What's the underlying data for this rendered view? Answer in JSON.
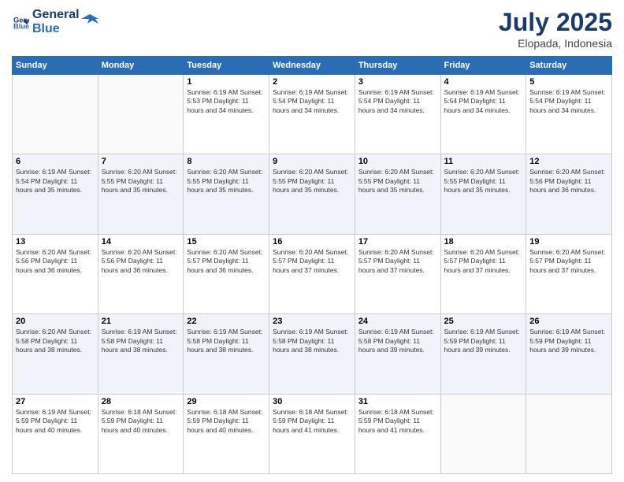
{
  "header": {
    "logo_line1": "General",
    "logo_line2": "Blue",
    "title": "July 2025",
    "subtitle": "Elopada, Indonesia"
  },
  "weekdays": [
    "Sunday",
    "Monday",
    "Tuesday",
    "Wednesday",
    "Thursday",
    "Friday",
    "Saturday"
  ],
  "weeks": [
    [
      {
        "day": "",
        "info": ""
      },
      {
        "day": "",
        "info": ""
      },
      {
        "day": "1",
        "info": "Sunrise: 6:19 AM\nSunset: 5:53 PM\nDaylight: 11 hours and 34 minutes."
      },
      {
        "day": "2",
        "info": "Sunrise: 6:19 AM\nSunset: 5:54 PM\nDaylight: 11 hours and 34 minutes."
      },
      {
        "day": "3",
        "info": "Sunrise: 6:19 AM\nSunset: 5:54 PM\nDaylight: 11 hours and 34 minutes."
      },
      {
        "day": "4",
        "info": "Sunrise: 6:19 AM\nSunset: 5:54 PM\nDaylight: 11 hours and 34 minutes."
      },
      {
        "day": "5",
        "info": "Sunrise: 6:19 AM\nSunset: 5:54 PM\nDaylight: 11 hours and 34 minutes."
      }
    ],
    [
      {
        "day": "6",
        "info": "Sunrise: 6:19 AM\nSunset: 5:54 PM\nDaylight: 11 hours and 35 minutes."
      },
      {
        "day": "7",
        "info": "Sunrise: 6:20 AM\nSunset: 5:55 PM\nDaylight: 11 hours and 35 minutes."
      },
      {
        "day": "8",
        "info": "Sunrise: 6:20 AM\nSunset: 5:55 PM\nDaylight: 11 hours and 35 minutes."
      },
      {
        "day": "9",
        "info": "Sunrise: 6:20 AM\nSunset: 5:55 PM\nDaylight: 11 hours and 35 minutes."
      },
      {
        "day": "10",
        "info": "Sunrise: 6:20 AM\nSunset: 5:55 PM\nDaylight: 11 hours and 35 minutes."
      },
      {
        "day": "11",
        "info": "Sunrise: 6:20 AM\nSunset: 5:55 PM\nDaylight: 11 hours and 35 minutes."
      },
      {
        "day": "12",
        "info": "Sunrise: 6:20 AM\nSunset: 5:56 PM\nDaylight: 11 hours and 36 minutes."
      }
    ],
    [
      {
        "day": "13",
        "info": "Sunrise: 6:20 AM\nSunset: 5:56 PM\nDaylight: 11 hours and 36 minutes."
      },
      {
        "day": "14",
        "info": "Sunrise: 6:20 AM\nSunset: 5:56 PM\nDaylight: 11 hours and 36 minutes."
      },
      {
        "day": "15",
        "info": "Sunrise: 6:20 AM\nSunset: 5:57 PM\nDaylight: 11 hours and 36 minutes."
      },
      {
        "day": "16",
        "info": "Sunrise: 6:20 AM\nSunset: 5:57 PM\nDaylight: 11 hours and 37 minutes."
      },
      {
        "day": "17",
        "info": "Sunrise: 6:20 AM\nSunset: 5:57 PM\nDaylight: 11 hours and 37 minutes."
      },
      {
        "day": "18",
        "info": "Sunrise: 6:20 AM\nSunset: 5:57 PM\nDaylight: 11 hours and 37 minutes."
      },
      {
        "day": "19",
        "info": "Sunrise: 6:20 AM\nSunset: 5:57 PM\nDaylight: 11 hours and 37 minutes."
      }
    ],
    [
      {
        "day": "20",
        "info": "Sunrise: 6:20 AM\nSunset: 5:58 PM\nDaylight: 11 hours and 38 minutes."
      },
      {
        "day": "21",
        "info": "Sunrise: 6:19 AM\nSunset: 5:58 PM\nDaylight: 11 hours and 38 minutes."
      },
      {
        "day": "22",
        "info": "Sunrise: 6:19 AM\nSunset: 5:58 PM\nDaylight: 11 hours and 38 minutes."
      },
      {
        "day": "23",
        "info": "Sunrise: 6:19 AM\nSunset: 5:58 PM\nDaylight: 11 hours and 38 minutes."
      },
      {
        "day": "24",
        "info": "Sunrise: 6:19 AM\nSunset: 5:58 PM\nDaylight: 11 hours and 39 minutes."
      },
      {
        "day": "25",
        "info": "Sunrise: 6:19 AM\nSunset: 5:59 PM\nDaylight: 11 hours and 39 minutes."
      },
      {
        "day": "26",
        "info": "Sunrise: 6:19 AM\nSunset: 5:59 PM\nDaylight: 11 hours and 39 minutes."
      }
    ],
    [
      {
        "day": "27",
        "info": "Sunrise: 6:19 AM\nSunset: 5:59 PM\nDaylight: 11 hours and 40 minutes."
      },
      {
        "day": "28",
        "info": "Sunrise: 6:18 AM\nSunset: 5:59 PM\nDaylight: 11 hours and 40 minutes."
      },
      {
        "day": "29",
        "info": "Sunrise: 6:18 AM\nSunset: 5:59 PM\nDaylight: 11 hours and 40 minutes."
      },
      {
        "day": "30",
        "info": "Sunrise: 6:18 AM\nSunset: 5:59 PM\nDaylight: 11 hours and 41 minutes."
      },
      {
        "day": "31",
        "info": "Sunrise: 6:18 AM\nSunset: 5:59 PM\nDaylight: 11 hours and 41 minutes."
      },
      {
        "day": "",
        "info": ""
      },
      {
        "day": "",
        "info": ""
      }
    ]
  ]
}
